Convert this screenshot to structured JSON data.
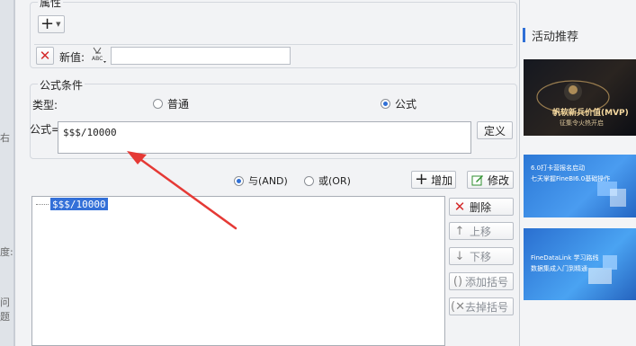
{
  "background_left": {
    "fragments": [
      "右",
      "度:",
      "问题"
    ]
  },
  "background_right": {
    "section_title": "活动推荐",
    "banners": [
      {
        "line1": "帆软新兵价值(MVP)",
        "line2": "征集令火热开启"
      },
      {
        "line1": "6.0打卡营报名启动",
        "line2": "七天掌握FineBI6.0基础操作"
      },
      {
        "line1": "FineDataLink 学习路线",
        "line2": "数据集成入门到精通"
      }
    ]
  },
  "dialog": {
    "attributes": {
      "title": "属性",
      "add_symbol": "+"
    },
    "new_value": {
      "label": "新值:",
      "value": ""
    },
    "formula_condition": {
      "title": "公式条件",
      "type_label": "类型:",
      "option_normal": "普通",
      "option_formula": "公式",
      "selected": "公式",
      "formula_label": "公式=",
      "formula_value": "$$$/10000",
      "define_button": "定义"
    },
    "logic": {
      "and_label": "与(AND)",
      "or_label": "或(OR)",
      "selected": "and",
      "add_button": "增加",
      "modify_button": "修改"
    },
    "condition_list": {
      "items": [
        "$$$/10000"
      ]
    },
    "side_buttons": {
      "delete": "删除",
      "move_up": "上移",
      "move_down": "下移",
      "add_bracket": "添加括号",
      "remove_bracket": "去掉括号"
    }
  },
  "colors": {
    "accent": "#2f6fd6",
    "annotation_arrow": "#e53935",
    "selection": "#3470d8"
  }
}
